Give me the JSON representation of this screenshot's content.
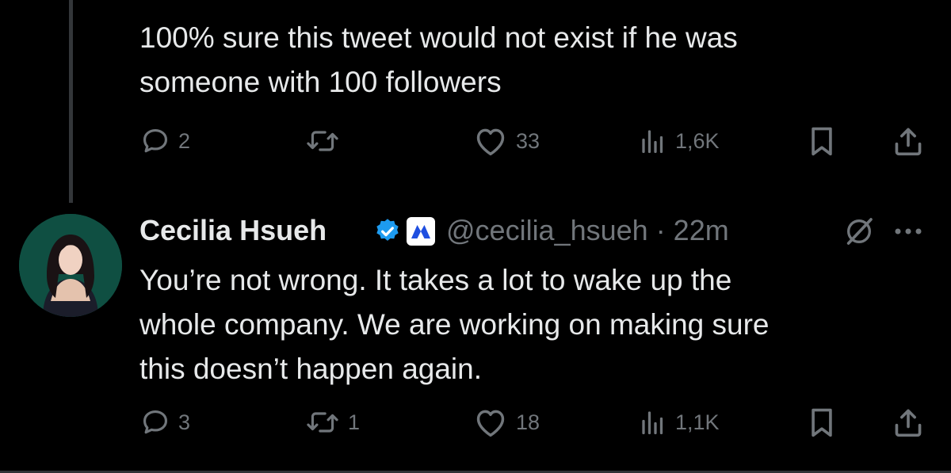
{
  "parent_tweet": {
    "text": "100% sure this tweet would not exist if he was\nsomeone with 100 followers",
    "actions": {
      "replies": "2",
      "reposts": "",
      "likes": "33",
      "views": "1,6K"
    }
  },
  "reply_tweet": {
    "author": {
      "display_name": "Cecilia Hsueh",
      "handle_time": "@cecilia_hsueh · 22m"
    },
    "text": "You’re not wrong. It takes a lot to wake up the\nwhole company. We are working on making sure\nthis doesn’t happen again.",
    "actions": {
      "replies": "3",
      "reposts": "1",
      "likes": "18",
      "views": "1,1K"
    }
  },
  "colors": {
    "background": "#000000",
    "text_primary": "#e7e9ea",
    "text_secondary": "#71767b",
    "verified_blue": "#1d9bf0",
    "affiliate_badge_blue": "#1f4fe0"
  },
  "icons": {
    "reply": "reply-icon",
    "repost": "repost-icon",
    "like": "like-icon",
    "views": "views-icon",
    "bookmark": "bookmark-icon",
    "share": "share-icon",
    "verified": "verified-badge-icon",
    "affiliate": "affiliate-badge-icon",
    "grok": "grok-icon",
    "more": "more-icon"
  }
}
